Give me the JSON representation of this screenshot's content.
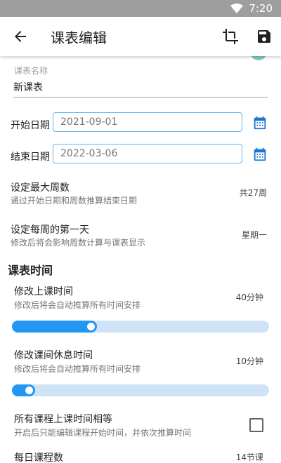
{
  "status_bar": {
    "time": "7:20"
  },
  "app_bar": {
    "title": "课表编辑"
  },
  "basic": {
    "name_label": "课表名称",
    "name_value": "新课表",
    "start_date_label": "开始日期",
    "start_date_value": "2021-09-01",
    "end_date_label": "结束日期",
    "end_date_value": "2022-03-06",
    "max_weeks_title": "设定最大周数",
    "max_weeks_sub": "通过开始日期和周数推算结束日期",
    "max_weeks_value": "共27周",
    "first_day_title": "设定每周的第一天",
    "first_day_sub": "修改后将会影响周数计算与课表显示",
    "first_day_value": "星期一"
  },
  "schedule": {
    "section_title": "课表时间",
    "class_time_title": "修改上课时间",
    "class_time_sub": "修改后将会自动推算所有时间安排",
    "class_time_value": "40分钟",
    "class_time_slider_percent": 33,
    "break_time_title": "修改课间休息时间",
    "break_time_sub": "修改后将会自动推算所有时间安排",
    "break_time_value": "10分钟",
    "break_time_slider_percent": 9,
    "equal_time_title": "所有课程上课时间相等",
    "equal_time_sub": "开启后只能编辑课程开始时间，并依次推算时间",
    "equal_time_checked": false,
    "daily_lessons_title": "每日课程数",
    "daily_lessons_value": "14节课"
  },
  "colors": {
    "accent": "#2196f3",
    "track": "#cfe3f7",
    "status_bar": "#9e9e9e",
    "field_border": "#64b5f6"
  },
  "icons": [
    "wifi-icon",
    "back-icon",
    "crop-icon",
    "save-icon",
    "calendar-icon"
  ]
}
